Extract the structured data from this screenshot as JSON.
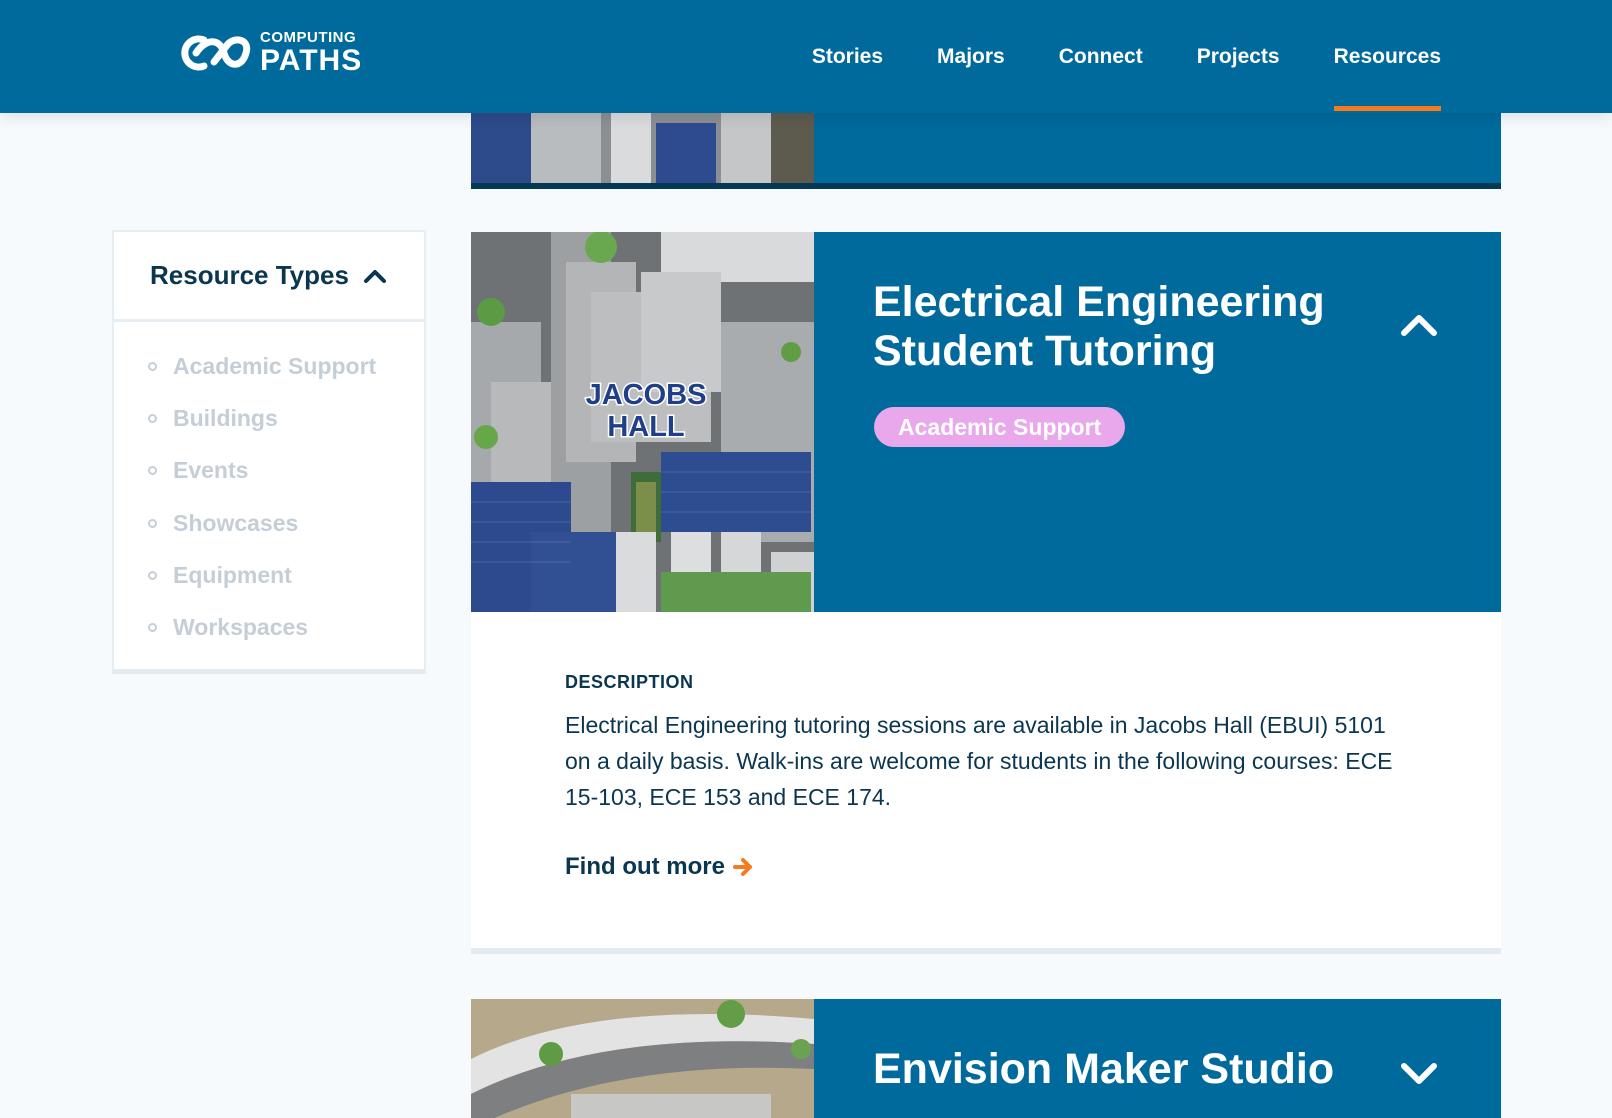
{
  "header": {
    "logo_small": "COMPUTING",
    "logo_big": "PATHS",
    "nav": [
      {
        "label": "Stories",
        "active": false
      },
      {
        "label": "Majors",
        "active": false
      },
      {
        "label": "Connect",
        "active": false
      },
      {
        "label": "Projects",
        "active": false
      },
      {
        "label": "Resources",
        "active": true
      }
    ]
  },
  "sidebar": {
    "title": "Resource Types",
    "toggle_icon": "chevron-up-icon",
    "items": [
      {
        "label": "Academic Support"
      },
      {
        "label": "Buildings"
      },
      {
        "label": "Events"
      },
      {
        "label": "Showcases"
      },
      {
        "label": "Equipment"
      },
      {
        "label": "Workspaces"
      }
    ]
  },
  "main_card": {
    "title": "Electrical Engineering Student Tutoring",
    "tag": "Academic Support",
    "map_label_1": "JACOBS",
    "map_label_2": "HALL",
    "description_label": "DESCRIPTION",
    "description": "Electrical Engineering tutoring sessions are available in Jacobs Hall (EBUI) 5101 on a daily basis. Walk-ins are welcome for students in the following courses: ECE 15-103, ECE 153 and ECE 174.",
    "link_label": "Find out more",
    "toggle_icon": "chevron-up-icon"
  },
  "next_card": {
    "title": "Envision Maker Studio",
    "toggle_icon": "chevron-down-icon"
  },
  "colors": {
    "brand_blue": "#006a9c",
    "accent_orange": "#f47b20",
    "tag_pink": "#e9a7ec",
    "text_dark": "#0b3650"
  }
}
